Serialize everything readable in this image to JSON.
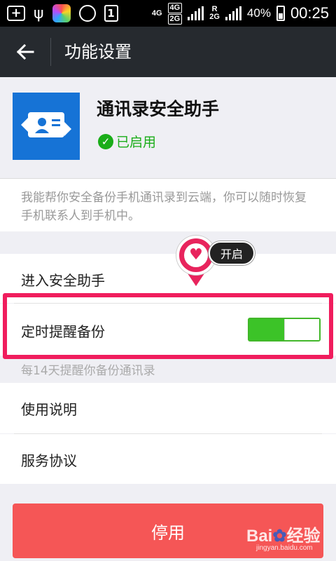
{
  "status_bar": {
    "network_top": "4G",
    "network_box": "4G",
    "network_box2": "2G",
    "roaming": "R",
    "network_bottom": "2G",
    "battery": "40%",
    "time": "00:25",
    "notification_count": "1"
  },
  "header": {
    "title": "功能设置"
  },
  "app": {
    "name": "通讯录安全助手",
    "status": "已启用",
    "description": "我能帮你安全备份手机通讯录到云端，你可以随时恢复手机联系人到手机中。"
  },
  "settings": {
    "enter_assistant": "进入安全助手",
    "scheduled_backup": "定时提醒备份",
    "scheduled_backup_enabled": true,
    "scheduled_backup_hint": "每14天提醒你备份通讯录",
    "instructions": "使用说明",
    "service_agreement": "服务协议"
  },
  "annotation": {
    "tag": "开启"
  },
  "footer": {
    "stop_button": "停用"
  },
  "watermark": {
    "logo_a": "Bai",
    "logo_b": "经验",
    "site": "jingyan.baidu.com"
  },
  "colors": {
    "accent_green": "#1aad19",
    "toggle_green": "#3cc328",
    "stop_red": "#f55656",
    "highlight_pink": "#f01d5d",
    "titlebar": "#262a2f"
  }
}
